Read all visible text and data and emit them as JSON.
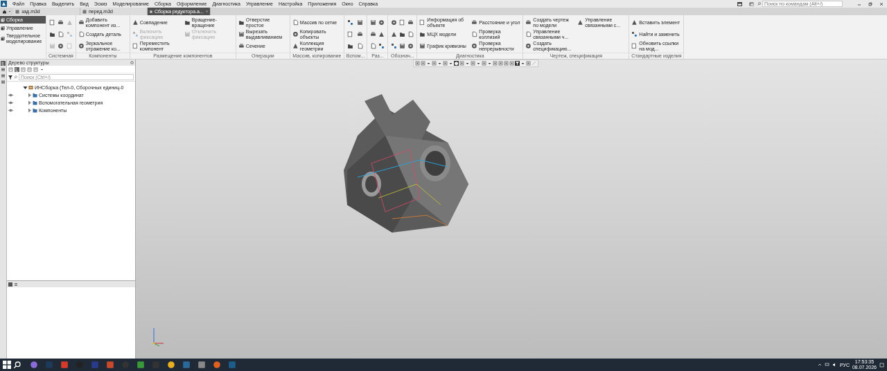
{
  "menu": [
    "Файл",
    "Правка",
    "Выделить",
    "Вид",
    "Эскиз",
    "Моделирование",
    "Сборка",
    "Оформление",
    "Диагностика",
    "Управление",
    "Настройка",
    "Приложения",
    "Окно",
    "Справка"
  ],
  "command_search": {
    "placeholder": "Поиск по командам (Alt+/)"
  },
  "doc_tabs": [
    {
      "label": "зад.m3d",
      "selected": false
    },
    {
      "label": "перед.m3d",
      "selected": false
    },
    {
      "label": "Сборка редуктора.a...",
      "selected": true
    }
  ],
  "ribbon": {
    "nav": [
      {
        "label": "Сборка",
        "selected": true
      },
      {
        "label": "Управление",
        "selected": false
      },
      {
        "label": "Твердотельное моделирование",
        "selected": false
      }
    ],
    "groups": [
      {
        "label": "Системная",
        "commands": [
          {
            "kind": "icon",
            "disabled": false
          },
          {
            "kind": "icon",
            "disabled": false
          },
          {
            "kind": "icon",
            "disabled": true
          },
          {
            "kind": "icon",
            "disabled": false
          },
          {
            "kind": "icon",
            "disabled": false
          },
          {
            "kind": "icon",
            "disabled": false
          },
          {
            "kind": "icon",
            "disabled": true
          },
          {
            "kind": "icon",
            "disabled": true
          },
          {
            "kind": "icon",
            "disabled": true
          }
        ]
      },
      {
        "label": "Компоненты",
        "commands": [
          {
            "kind": "label",
            "label": "Добавить компонент из...",
            "disabled": false
          },
          {
            "kind": "label",
            "label": "Создать деталь",
            "disabled": false
          },
          {
            "kind": "label",
            "label": "Зеркальное отражение ко...",
            "disabled": false
          }
        ]
      },
      {
        "label": "Размещение компонентов",
        "commands": [
          {
            "kind": "label",
            "label": "Совпадение",
            "disabled": false
          },
          {
            "kind": "label",
            "label": "Включить фиксацию",
            "disabled": true
          },
          {
            "kind": "label",
            "label": "Переместить компонент",
            "disabled": false
          },
          {
            "kind": "label",
            "label": "Вращение-вращение",
            "disabled": false
          },
          {
            "kind": "label",
            "label": "Отключить фиксацию",
            "disabled": true
          }
        ]
      },
      {
        "label": "Операции",
        "commands": [
          {
            "kind": "label",
            "label": "Отверстие простое",
            "disabled": false
          },
          {
            "kind": "label",
            "label": "Вырезать выдавливанием",
            "disabled": false
          },
          {
            "kind": "label",
            "label": "Сечение",
            "disabled": false
          }
        ]
      },
      {
        "label": "Массив, копирование",
        "commands": [
          {
            "kind": "label",
            "label": "Массив по сетке",
            "disabled": false
          },
          {
            "kind": "label",
            "label": "Копировать объекты",
            "disabled": false
          },
          {
            "kind": "label",
            "label": "Коллекция геометрии",
            "disabled": false
          }
        ]
      },
      {
        "label": "Вспом...",
        "commands": [
          {
            "kind": "icon",
            "disabled": false
          },
          {
            "kind": "icon",
            "disabled": false
          },
          {
            "kind": "icon",
            "disabled": false
          },
          {
            "kind": "icon",
            "disabled": false
          },
          {
            "kind": "icon",
            "disabled": false
          },
          {
            "kind": "icon",
            "disabled": false
          }
        ]
      },
      {
        "label": "Раз...",
        "commands": [
          {
            "kind": "icon",
            "disabled": false
          },
          {
            "kind": "icon",
            "disabled": false
          },
          {
            "kind": "icon",
            "disabled": false
          },
          {
            "kind": "icon",
            "disabled": false
          },
          {
            "kind": "icon",
            "disabled": false
          },
          {
            "kind": "icon",
            "disabled": false
          }
        ]
      },
      {
        "label": "Обознач...",
        "commands": [
          {
            "kind": "icon",
            "disabled": false
          },
          {
            "kind": "icon",
            "disabled": false
          },
          {
            "kind": "icon",
            "disabled": false
          },
          {
            "kind": "icon",
            "disabled": false
          },
          {
            "kind": "icon",
            "disabled": false
          },
          {
            "kind": "icon",
            "disabled": false
          },
          {
            "kind": "icon",
            "disabled": false
          },
          {
            "kind": "icon",
            "disabled": false
          },
          {
            "kind": "icon",
            "disabled": false
          }
        ]
      },
      {
        "label": "Диагностика",
        "commands": [
          {
            "kind": "label",
            "label": "Информация об объекте",
            "disabled": false
          },
          {
            "kind": "label",
            "label": "МЦХ модели",
            "disabled": false
          },
          {
            "kind": "label",
            "label": "График кривизны",
            "disabled": false
          },
          {
            "kind": "label",
            "label": "Расстояние и угол",
            "disabled": false
          },
          {
            "kind": "label",
            "label": "Проверка коллизий",
            "disabled": false
          },
          {
            "kind": "label",
            "label": "Проверка непрерывности",
            "disabled": false
          }
        ]
      },
      {
        "label": "Чертеж, спецификация",
        "commands": [
          {
            "kind": "label",
            "label": "Создать чертеж по модели",
            "disabled": false
          },
          {
            "kind": "label",
            "label": "Управление связанными ч...",
            "disabled": false
          },
          {
            "kind": "label",
            "label": "Создать спецификацию...",
            "disabled": false
          },
          {
            "kind": "label",
            "label": "Управление связанными с...",
            "disabled": false
          }
        ]
      },
      {
        "label": "Стандартные изделия",
        "commands": [
          {
            "kind": "label",
            "label": "Вставить элемент",
            "disabled": false
          },
          {
            "kind": "label",
            "label": "Найти и заменить",
            "disabled": false
          },
          {
            "kind": "label",
            "label": "Обновить ссылки на мод...",
            "disabled": false
          }
        ]
      }
    ]
  },
  "tree": {
    "title": "Дерево структуры",
    "search": {
      "placeholder": "Поиск (Ctrl+/)"
    },
    "items": [
      {
        "label": "ИНСборка (Тел-0, Сборочных единиц-0",
        "expanded": true,
        "children": [
          {
            "label": "Системы координат",
            "expanded": false
          },
          {
            "label": "Вспомогательная геометрия",
            "expanded": false
          },
          {
            "label": "Компоненты",
            "expanded": false
          }
        ]
      }
    ]
  },
  "taskbar": {
    "language": "РУС",
    "time": "17:53:35",
    "date": "08.07.2026"
  }
}
